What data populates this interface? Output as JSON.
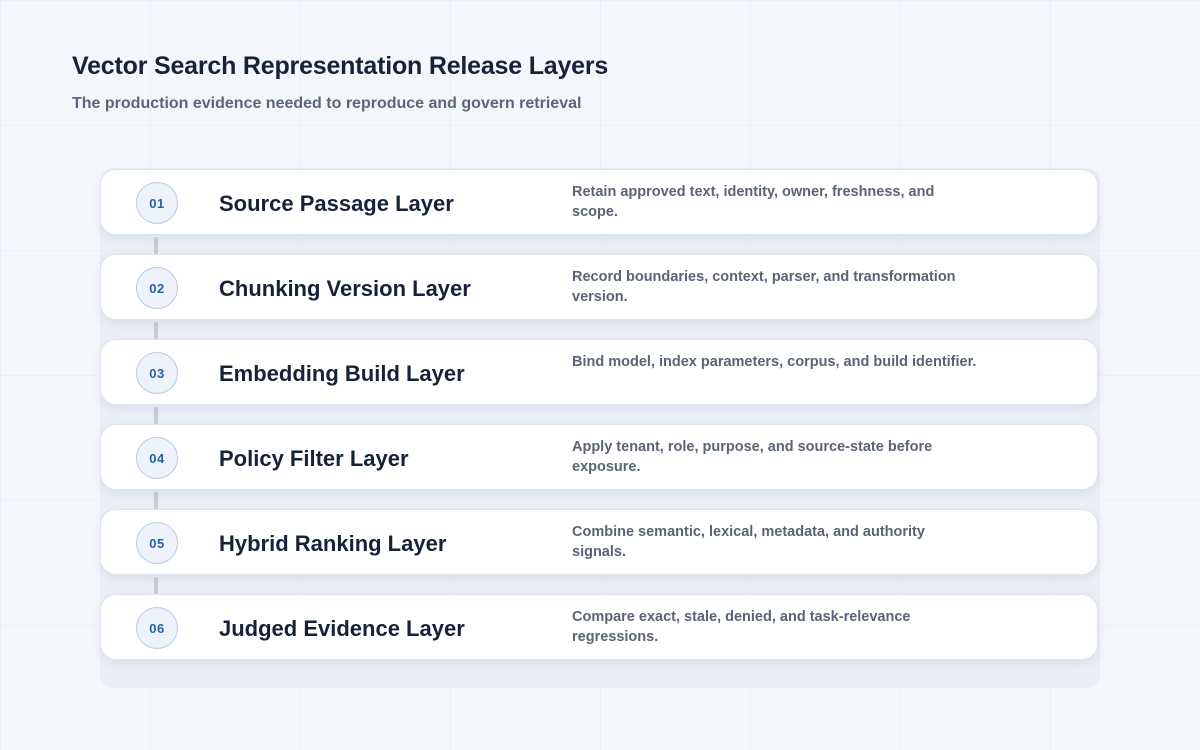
{
  "header": {
    "title": "Vector Search Representation Release Layers",
    "subtitle": "The production evidence needed to reproduce and govern retrieval"
  },
  "layers": [
    {
      "number": "01",
      "name": "Source Passage Layer",
      "description": "Retain approved text, identity, owner, freshness, and scope."
    },
    {
      "number": "02",
      "name": "Chunking Version Layer",
      "description": "Record boundaries, context, parser, and transformation version."
    },
    {
      "number": "03",
      "name": "Embedding Build Layer",
      "description": "Bind model, index parameters, corpus, and build identifier."
    },
    {
      "number": "04",
      "name": "Policy Filter Layer",
      "description": "Apply tenant, role, purpose, and source-state before exposure."
    },
    {
      "number": "05",
      "name": "Hybrid Ranking Layer",
      "description": "Combine semantic, lexical, metadata, and authority signals."
    },
    {
      "number": "06",
      "name": "Judged Evidence Layer",
      "description": "Compare exact, stale, denied, and task-relevance regressions."
    }
  ]
}
